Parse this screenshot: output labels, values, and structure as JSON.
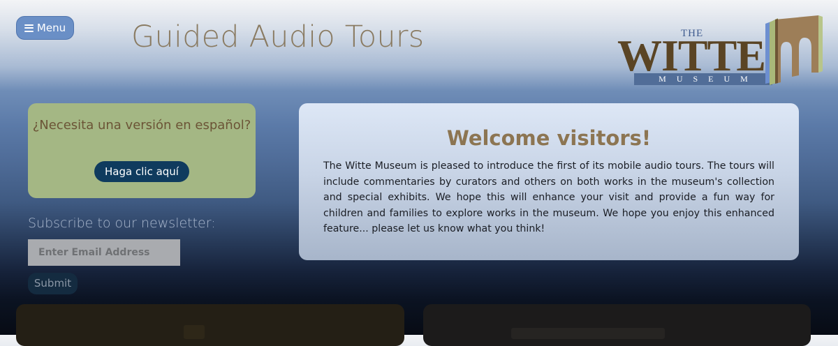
{
  "header": {
    "menu_label": "Menu",
    "title": "Guided Audio Tours"
  },
  "logo": {
    "the": "THE",
    "name": "WITTE",
    "museum": "MUSEUM"
  },
  "spanish": {
    "question": "¿Necesita una versión en español?",
    "button_label": "Haga clic aquí"
  },
  "newsletter": {
    "label": "Subscribe to our newsletter:",
    "email_placeholder": "Enter Email Address",
    "submit_label": "Submit"
  },
  "welcome": {
    "heading": "Welcome visitors!",
    "body": "The Witte Museum is pleased to introduce the first of its mobile audio tours. The tours will include commentaries by curators and others on both works in the museum's collection and special exhibits. We hope this will enhance your visit and provide a fun way for children and families to explore works in the museum. We hope you enjoy this enhanced feature... please let us know what you think!"
  },
  "colors": {
    "accent_brown": "#8c7552",
    "menu_blue": "#6a8fc6",
    "spanish_card_green": "#a4b784",
    "spanish_button_navy": "#0f3b5e"
  }
}
